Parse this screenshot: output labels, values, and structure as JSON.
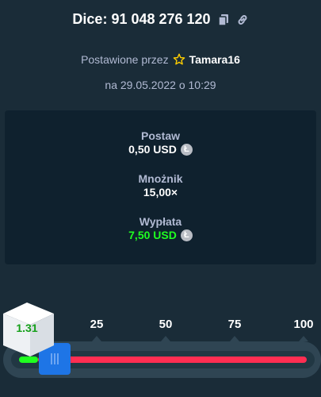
{
  "header": {
    "title": "Dice: 91 048 276 120",
    "copy_icon": "copy-icon",
    "link_icon": "link-icon"
  },
  "placed": {
    "prefix": "Postawione przez",
    "user": "Tamara16",
    "star_icon": "star-icon"
  },
  "date": "na 29.05.2022 o 10:29",
  "stats": {
    "bet_label": "Postaw",
    "bet_value": "0,50 USD",
    "multiplier_label": "Mnożnik",
    "multiplier_value": "15,00×",
    "payout_label": "Wypłata",
    "payout_value": "7,50 USD",
    "currency_icon": "litecoin-icon"
  },
  "slider": {
    "ticks": [
      "25",
      "50",
      "75",
      "100"
    ],
    "result": "1.31",
    "threshold_percent": 6.6,
    "colors": {
      "win": "#1fff20",
      "lose": "#ff2e52",
      "handle": "#1e75e6"
    }
  }
}
